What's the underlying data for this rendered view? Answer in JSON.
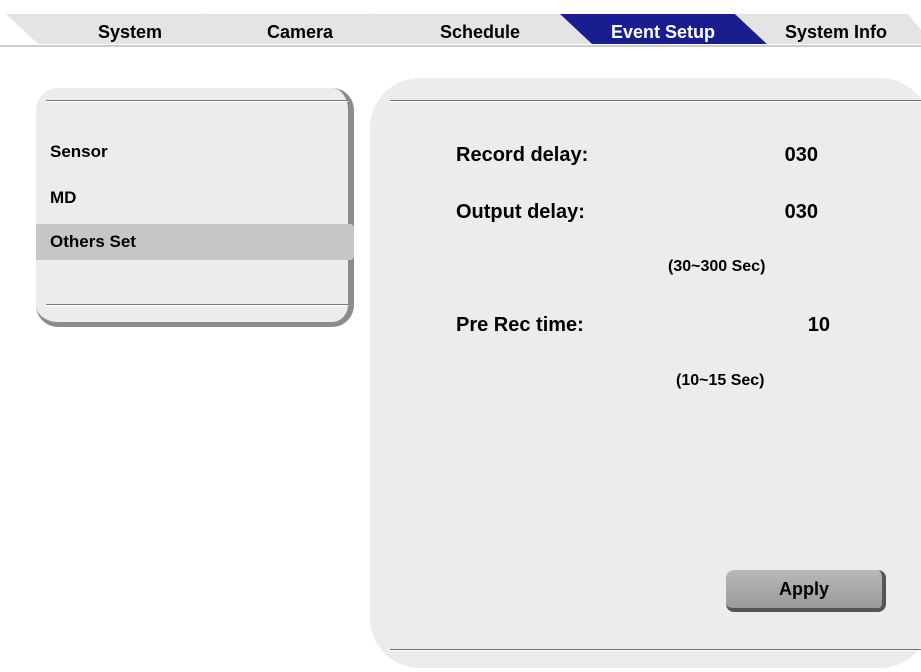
{
  "tabs": [
    {
      "label": "System",
      "active": false
    },
    {
      "label": "Camera",
      "active": false
    },
    {
      "label": "Schedule",
      "active": false
    },
    {
      "label": "Event Setup",
      "active": true
    },
    {
      "label": "System Info",
      "active": false
    }
  ],
  "colors": {
    "active_tab": "#1a1d8f",
    "inactive_tab": "#e4e4e4",
    "panel": "#ececec",
    "selected_item": "#c6c6c6",
    "button": "#a8a8a8"
  },
  "menu": {
    "items": [
      {
        "label": "Sensor",
        "selected": false
      },
      {
        "label": "MD",
        "selected": false
      },
      {
        "label": "Others Set",
        "selected": true
      }
    ]
  },
  "settings": {
    "record_delay": {
      "label": "Record delay:",
      "value": "030"
    },
    "output_delay": {
      "label": "Output delay:",
      "value": "030",
      "range": "(30~300 Sec)"
    },
    "pre_rec_time": {
      "label": "Pre Rec time:",
      "value": "10",
      "range": "(10~15 Sec)"
    }
  },
  "apply_label": "Apply"
}
